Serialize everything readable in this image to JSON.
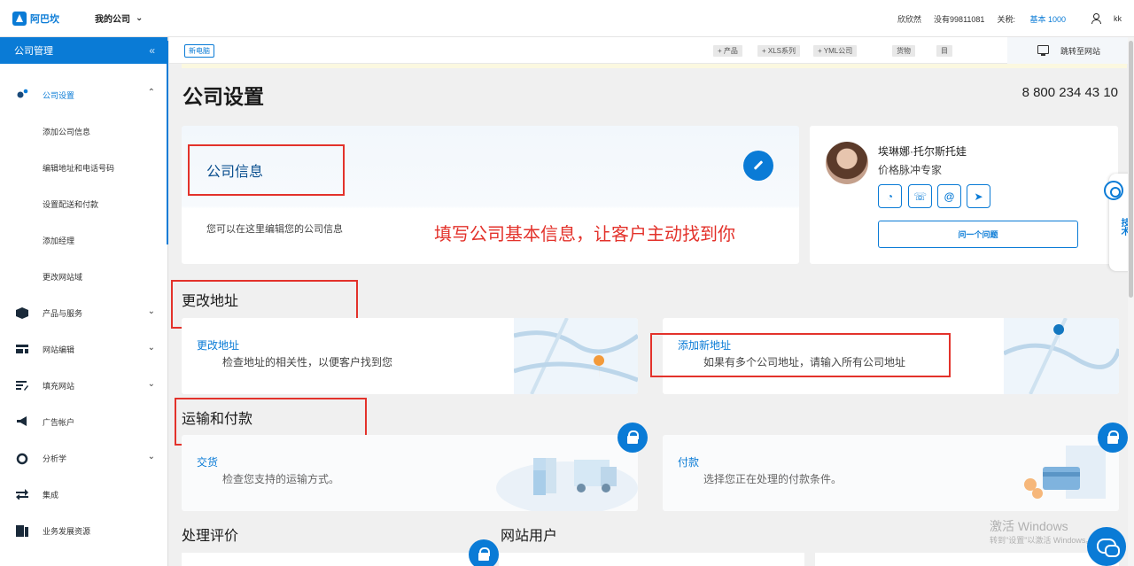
{
  "topbar": {
    "logo_text": "阿巴坎",
    "company": "我的公司",
    "user_name_1": "欣欣然",
    "phone_label": "没有99811081",
    "tariff_label": "关税:",
    "tariff_value": "基本 1000",
    "user": "kk"
  },
  "sidebar": {
    "header": "公司管理",
    "section": "公司设置",
    "subitems": [
      "添加公司信息",
      "编辑地址和电话号码",
      "设置配送和付款",
      "添加经理",
      "更改网站域"
    ],
    "items": [
      "产品与服务",
      "网站编辑",
      "填充网站",
      "广告帐户",
      "分析学",
      "集成",
      "业务发展资源"
    ]
  },
  "toolbar": {
    "badge": "新电脑",
    "buttons": [
      "+ 产品",
      "+ XLS系列",
      "+ YML公司",
      "货物",
      "目"
    ],
    "jump": "跳转至网站"
  },
  "main": {
    "title": "公司设置",
    "phone": "8 800 234 43 10",
    "info_title": "公司信息",
    "info_desc": "您可以在这里编辑您的公司信息",
    "annotation": "填写公司基本信息，让客户主动找到你",
    "expert": {
      "name": "埃琳娜·托尔斯托娃",
      "role": "价格脉冲专家",
      "social": [
        "whatsapp-icon",
        "viber-icon",
        "email-icon",
        "telegram-icon"
      ],
      "ask": "问一个问题"
    },
    "address_section": "更改地址",
    "address_cards": [
      {
        "link": "更改地址",
        "desc": "检查地址的相关性，以便客户找到您"
      },
      {
        "link": "添加新地址",
        "desc": "如果有多个公司地址，请输入所有公司地址"
      }
    ],
    "shipping_section": "运输和付款",
    "shipping_cards": [
      {
        "link": "交货",
        "desc": "检查您支持的运输方式。"
      },
      {
        "link": "付款",
        "desc": "选择您正在处理的付款条件。"
      }
    ],
    "bottom_titles": [
      "处理评价",
      "网站用户"
    ]
  },
  "overlay": {
    "watermark_1": "激活 Windows",
    "watermark_2": "转到\"设置\"以激活 Windows。",
    "side_widget": "技术"
  },
  "colors": {
    "accent": "#0a7bd6",
    "annotation": "#e3322b"
  }
}
